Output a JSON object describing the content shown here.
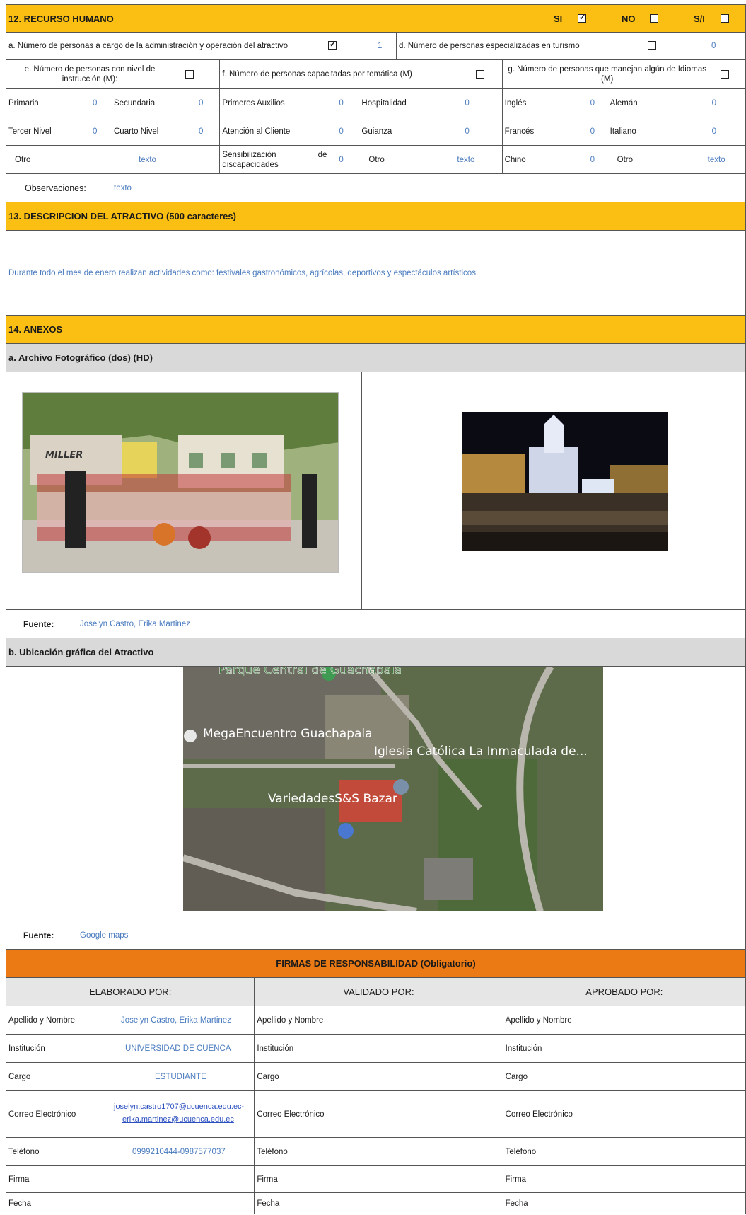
{
  "s12": {
    "title": "12. RECURSO HUMANO",
    "si": "SI",
    "no": "NO",
    "sn": "S/I",
    "a_label": "a. Número de personas a cargo de la administración y operación del atractivo",
    "a_value": "1",
    "d_label": "d. Número de personas especializadas en turismo",
    "d_value": "0",
    "e_label": "e. Número de personas con nivel de instrucción (M):",
    "f_label": "f. Número de personas capacitadas por temática (M)",
    "g_label": "g. Número de personas que manejan algún de Idiomas (M)",
    "rows": [
      [
        "Primaria",
        "0",
        "Secundaria",
        "0",
        "Primeros Auxilios",
        "0",
        "Hospitalidad",
        "0",
        "Inglés",
        "0",
        "Alemán",
        "0"
      ],
      [
        "Tercer Nivel",
        "0",
        "Cuarto Nivel",
        "0",
        "Atención al Cliente",
        "0",
        "Guianza",
        "0",
        "Francés",
        "0",
        "Italiano",
        "0"
      ],
      [
        "Otro",
        "texto",
        "",
        "",
        "Sensibilización de discapacidades",
        "0",
        "Otro",
        "texto",
        "Chino",
        "0",
        "Otro",
        "texto"
      ]
    ],
    "obs_label": "Observaciones:",
    "obs_value": "texto"
  },
  "s13": {
    "title": "13. DESCRIPCION DEL ATRACTIVO (500 caracteres)",
    "text": "Durante todo el mes de enero realizan actividades como: festivales gastronómicos, agrícolas, deportivos y espectáculos artísticos."
  },
  "s14": {
    "title": "14. ANEXOS",
    "a_title": "a. Archivo Fotográfico (dos) (HD)",
    "photo1_sign": "MILLER",
    "fuente_label": "Fuente:",
    "fuente1": "Joselyn Castro, Erika Martinez",
    "b_title": "b. Ubicación gráfica del Atractivo",
    "map_labels": [
      "Parque Central de Guachapala",
      "MegaEncuentro Guachapala",
      "Iglesia Católica La Inmaculada de...",
      "VariedadesS&S Bazar"
    ],
    "fuente2": "Google maps"
  },
  "firmas": {
    "title": "FIRMAS DE RESPONSABILIDAD (Obligatorio)",
    "cols": [
      "ELABORADO POR:",
      "VALIDADO POR:",
      "APROBADO POR:"
    ],
    "labels": [
      "Apellido y Nombre",
      "Institución",
      "Cargo",
      "Correo Electrónico",
      "Teléfono",
      "Firma",
      "Fecha"
    ],
    "values": [
      "Joselyn Castro, Erika Martinez",
      "UNIVERSIDAD DE CUENCA",
      "ESTUDIANTE",
      "",
      "0999210444-0987577037",
      "",
      ""
    ],
    "email1": "joselyn.castro1707@ucuenca.edu.ec-",
    "email2": "erika.martinez@ucuenca.edu.ec"
  }
}
